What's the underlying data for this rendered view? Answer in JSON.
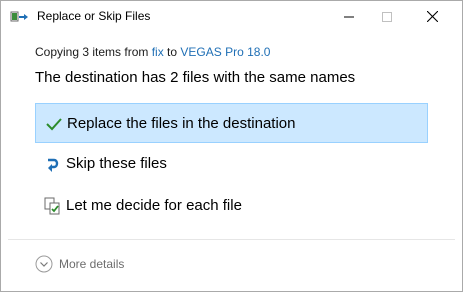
{
  "window": {
    "title": "Replace or Skip Files"
  },
  "status": {
    "prefix": "Copying 3 items from ",
    "source": "fix",
    "middle": " to ",
    "destination": "VEGAS Pro 18.0"
  },
  "headline": "The destination has 2 files with the same names",
  "options": [
    {
      "label": "Replace the files in the destination",
      "icon": "checkmark-icon",
      "selected": true
    },
    {
      "label": "Skip these files",
      "icon": "skip-arrow-icon",
      "selected": false
    },
    {
      "label": "Let me decide for each file",
      "icon": "compare-files-icon",
      "selected": false
    }
  ],
  "footer": {
    "more_details": "More details",
    "icon": "chevron-down-circle-icon"
  },
  "colors": {
    "link": "#1f6fb5",
    "selection_bg": "#cce8ff",
    "selection_border": "#99d1ff",
    "check_green": "#2c8c2c",
    "skip_blue": "#1f6fb5"
  }
}
